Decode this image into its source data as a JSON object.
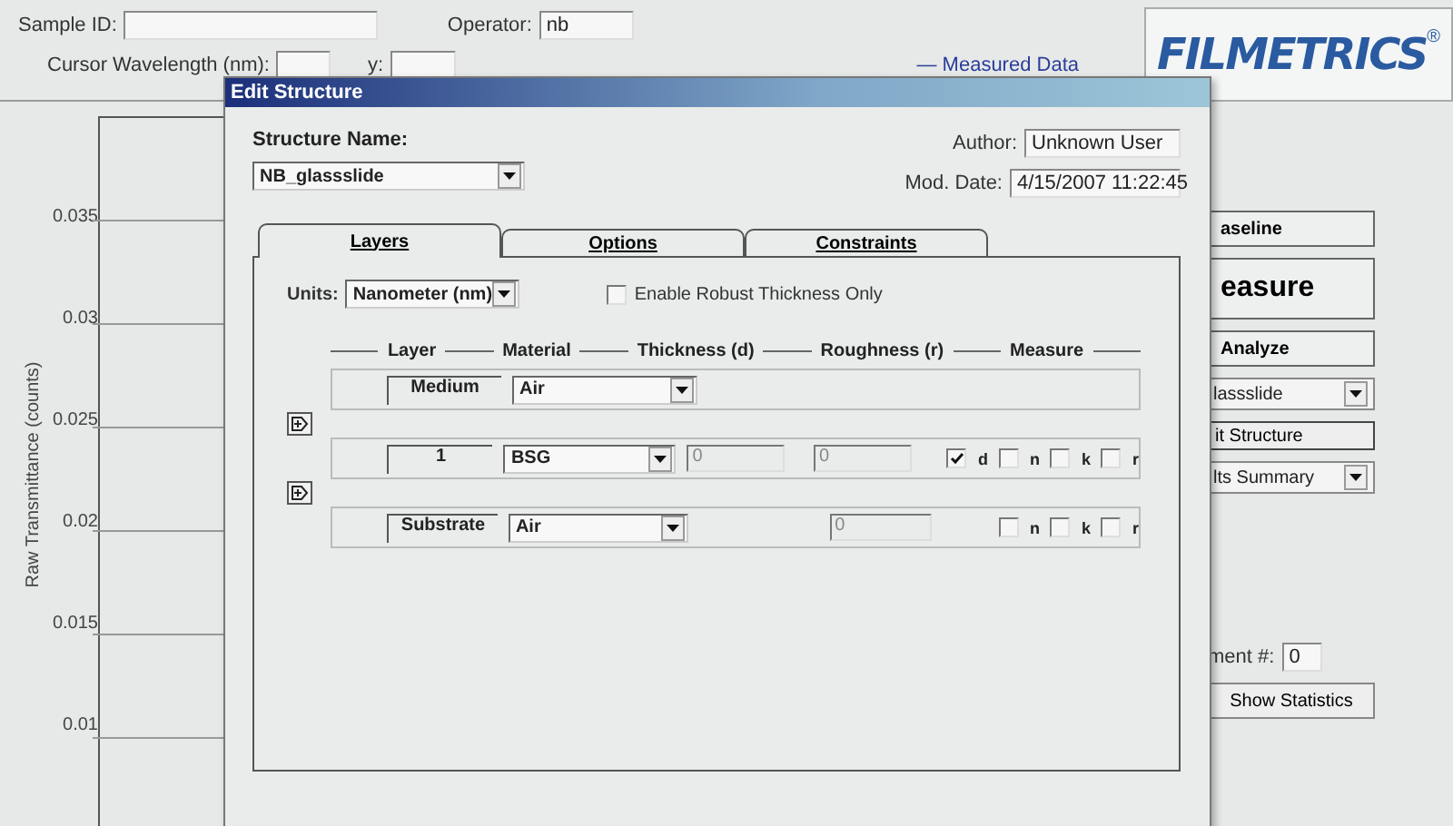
{
  "app": {
    "sample_id": {
      "label": "Sample ID:"
    },
    "operator": {
      "label": "Operator:",
      "value": "nb"
    },
    "cursor_wavelength": {
      "label": "Cursor Wavelength (nm):"
    },
    "cursor_y": {
      "label": "y:"
    },
    "legend": "— Measured Data",
    "logo": "FILMETRICS",
    "logo_mark": "®"
  },
  "chart": {
    "ylabel": "Raw Transmittance (counts)",
    "yticks": [
      "0.035",
      "0.03",
      "0.025",
      "0.02",
      "0.015",
      "0.01"
    ]
  },
  "side_panel": {
    "buttons": [
      {
        "label": "aseline",
        "kind": "small"
      },
      {
        "label": "easure",
        "kind": "large"
      },
      {
        "label": "Analyze",
        "kind": "small"
      }
    ],
    "structure_select": "lassslide",
    "edit_button": "it Structure",
    "results_select": "lts Summary",
    "measurement": {
      "label": "ment #:",
      "value": "0"
    },
    "stats_button": "Show Statistics"
  },
  "dialog": {
    "title": "Edit Structure",
    "structure_name_label": "Structure Name:",
    "structure_name": "NB_glassslide",
    "author_label": "Author:",
    "author": "Unknown User",
    "mod_date_label": "Mod. Date:",
    "mod_date": "4/15/2007 11:22:45",
    "tabs": [
      {
        "label": "Layers",
        "selected": true
      },
      {
        "label": "Options",
        "selected": false
      },
      {
        "label": "Constraints",
        "selected": false
      }
    ],
    "units_label": "Units:",
    "units": "Nanometer (nm)",
    "robust": {
      "label": "Enable Robust Thickness Only",
      "checked": false
    },
    "columns": [
      "Layer",
      "Material",
      "Thickness (d)",
      "Roughness (r)",
      "Measure"
    ],
    "layers": [
      {
        "kind": "medium",
        "name": "Medium",
        "material": "Air"
      },
      {
        "kind": "layer",
        "name": "1",
        "material": "BSG",
        "thickness": "0",
        "roughness": "0",
        "measure": [
          {
            "label": "d",
            "checked": true
          },
          {
            "label": "n",
            "checked": false
          },
          {
            "label": "k",
            "checked": false
          },
          {
            "label": "r",
            "checked": false
          }
        ]
      },
      {
        "kind": "substrate",
        "name": "Substrate",
        "material": "Air",
        "roughness": "0",
        "measure": [
          {
            "label": "n",
            "checked": false
          },
          {
            "label": "k",
            "checked": false
          },
          {
            "label": "r",
            "checked": false
          }
        ]
      }
    ]
  }
}
